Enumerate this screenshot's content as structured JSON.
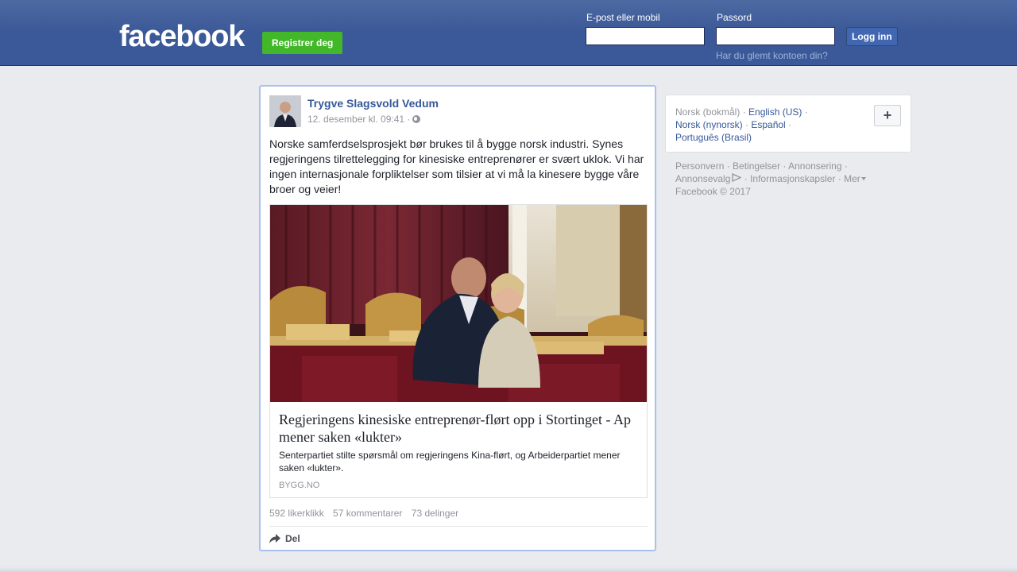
{
  "header": {
    "logo": "facebook",
    "register_label": "Registrer deg",
    "email_label": "E-post eller mobil",
    "email_value": "",
    "password_label": "Passord",
    "password_value": "",
    "login_label": "Logg inn",
    "forgot_label": "Har du glemt kontoen din?"
  },
  "post": {
    "author": "Trygve Slagsvold Vedum",
    "timestamp": "12. desember kl. 09:41 ·",
    "privacy_icon": "globe-icon",
    "text": "Norske samferdselsprosjekt bør brukes til å bygge norsk industri. Synes regjeringens tilrettelegging for kinesiske entreprenører er svært uklok. Vi har ingen internasjonale forpliktelser som tilsier at vi må la kinesere bygge våre broer og veier!",
    "link": {
      "title": "Regjeringens kinesiske entreprenør-flørt opp i Stortinget - Ap mener saken «lukter»",
      "description": "Senterpartiet stilte spørsmål om regjeringens Kina-flørt, og Arbeiderpartiet mener saken «lukter».",
      "domain": "BYGG.NO"
    },
    "stats": {
      "likes": "592 likerklikk",
      "comments": "57 kommentarer",
      "shares": "73 delinger"
    },
    "share_label": "Del"
  },
  "languages": {
    "current": "Norsk (bokmål)",
    "others": [
      "English (US)",
      "Norsk (nynorsk)",
      "Español",
      "Português (Brasil)"
    ],
    "more_icon": "plus-icon"
  },
  "footer": {
    "links": [
      "Personvern",
      "Betingelser",
      "Annonsering",
      "Annonsevalg",
      "Informasjonskapsler",
      "Mer"
    ],
    "copyright": "Facebook © 2017"
  },
  "colors": {
    "brand_blue": "#3b5998",
    "register_green": "#42b72a",
    "link_blue": "#365899"
  }
}
